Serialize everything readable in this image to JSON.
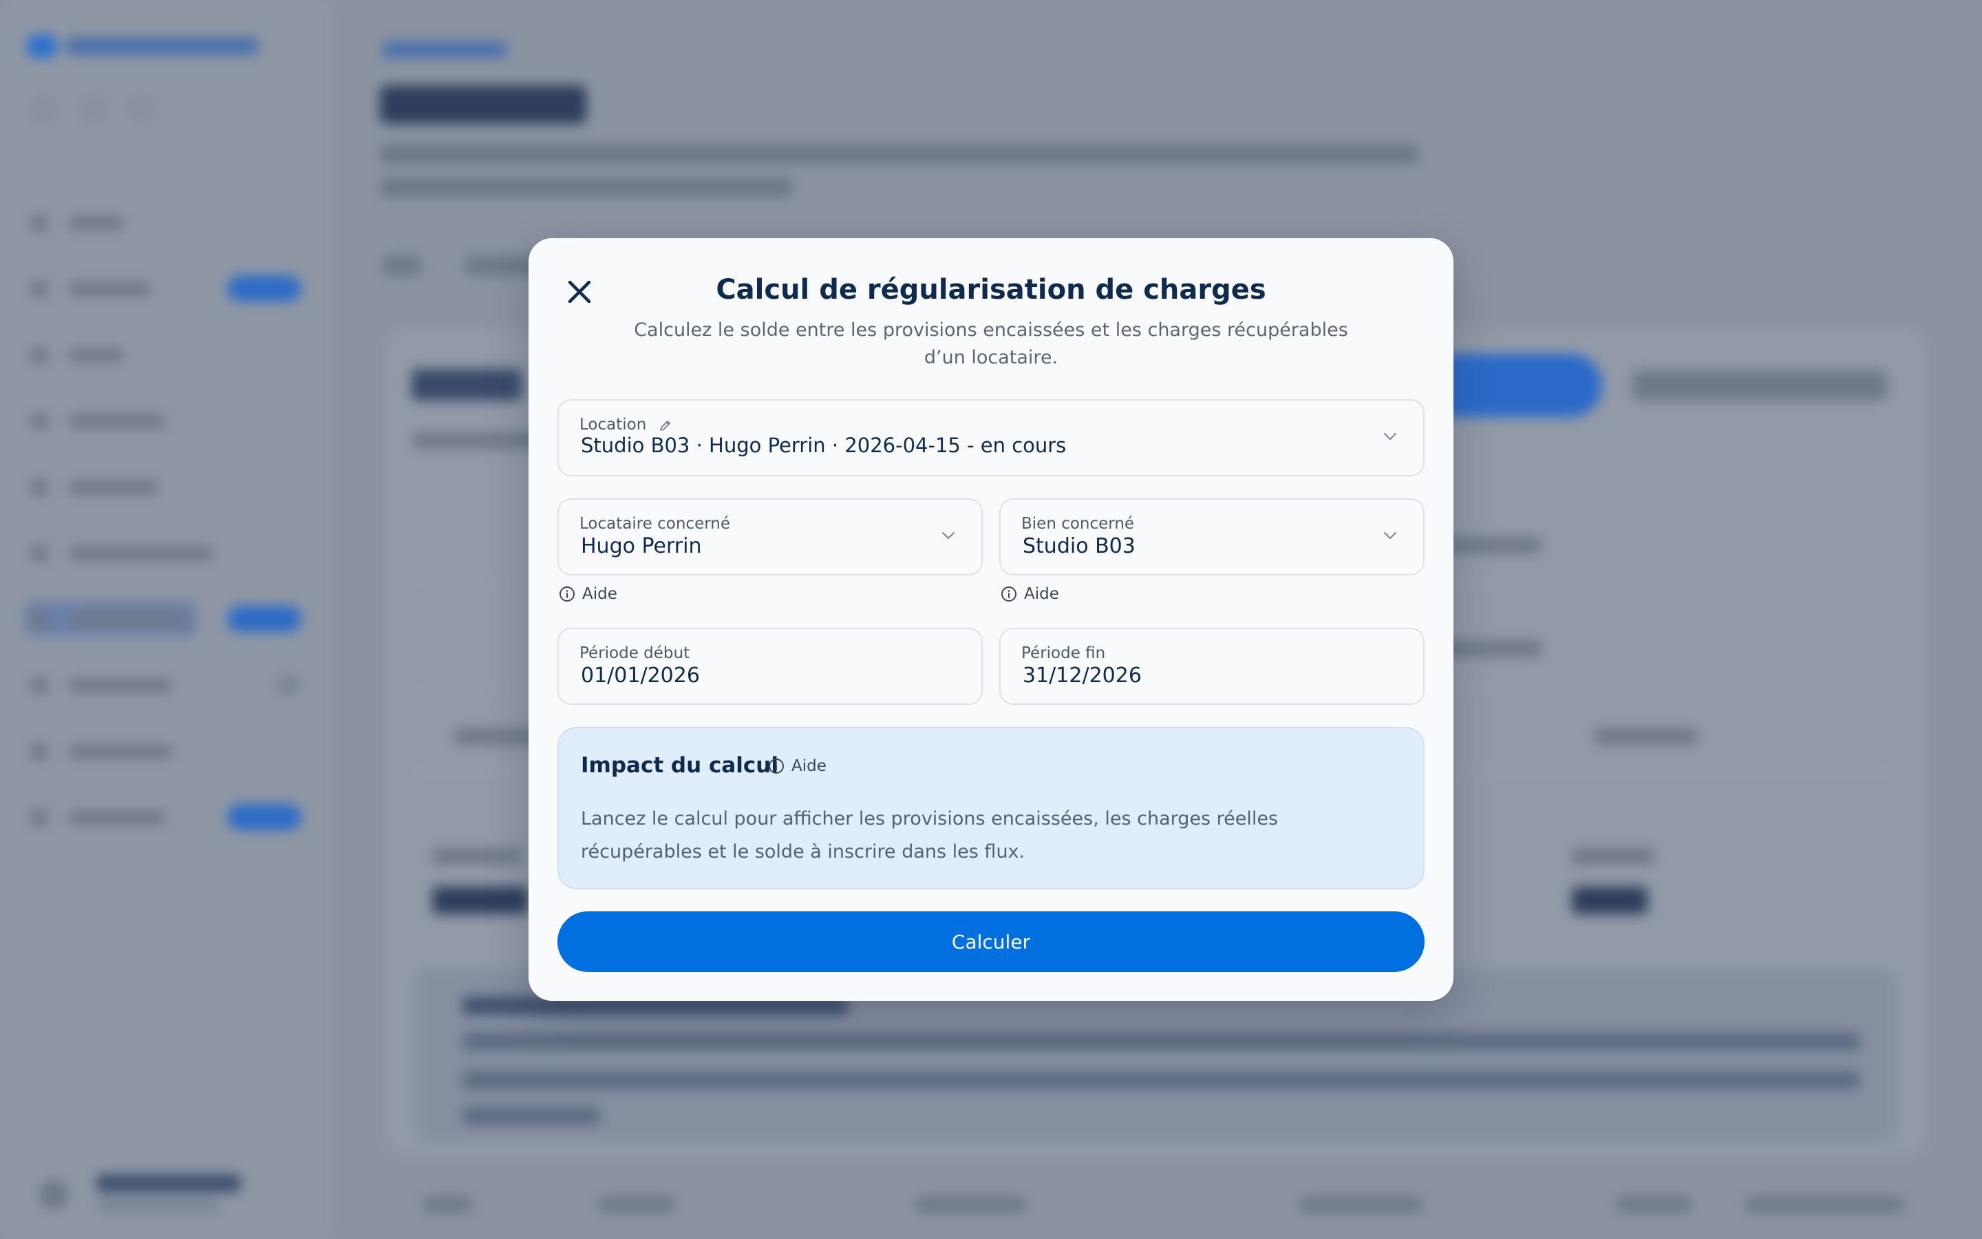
{
  "modal": {
    "title": "Calcul de régularisation de charges",
    "subtitle": "Calculez le solde entre les provisions encaissées et les charges récupérables d’un locataire.",
    "close_icon": "close-icon",
    "location": {
      "label": "Location",
      "value": "Studio B03 · Hugo Perrin · 2026-04-15 - en cours"
    },
    "tenant": {
      "label": "Locataire concerné",
      "value": "Hugo Perrin",
      "help": "Aide"
    },
    "property": {
      "label": "Bien concerné",
      "value": "Studio B03",
      "help": "Aide"
    },
    "period_start": {
      "label": "Période début",
      "value": "01/01/2026"
    },
    "period_end": {
      "label": "Période fin",
      "value": "31/12/2026"
    },
    "impact": {
      "title": "Impact du calcul",
      "help": "Aide",
      "text": "Lancez le calcul pour afficher les provisions encaissées, les charges réelles récupérables et le solde à inscrire dans les flux."
    },
    "submit_label": "Calculer"
  },
  "colors": {
    "primary": "#0070e0",
    "title": "#0f2a4f",
    "impact_bg": "#e0edfb"
  }
}
